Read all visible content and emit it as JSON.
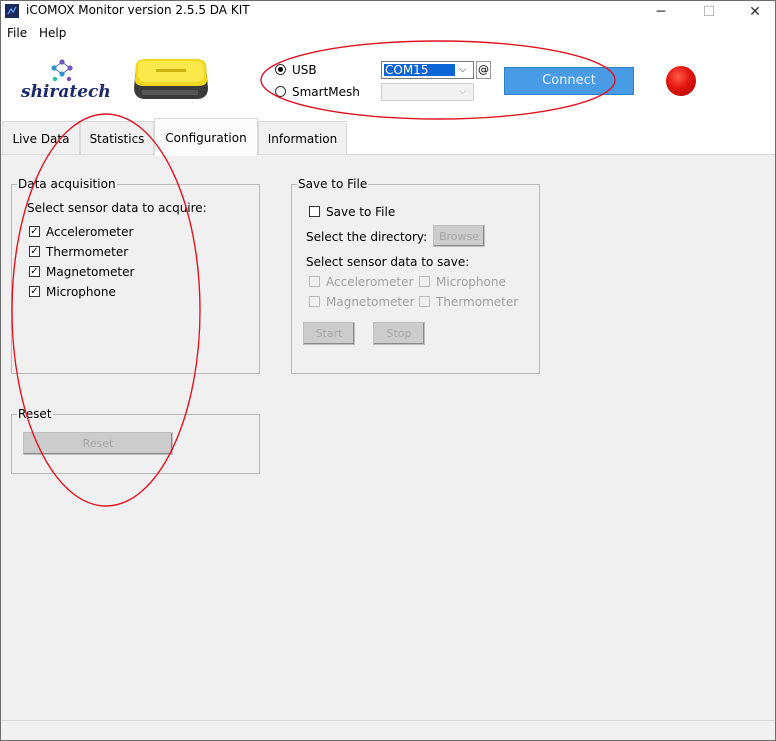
{
  "window": {
    "title": "iCOMOX Monitor version 2.5.5 DA KIT",
    "minimize": "─",
    "maximize": "☐",
    "close": "✕"
  },
  "menu": {
    "file": "File",
    "help": "Help"
  },
  "branding": {
    "logo_text": "shiratech"
  },
  "connection": {
    "usb_label": "USB",
    "smartmesh_label": "SmartMesh",
    "usb_selected": true,
    "com_port": "COM15",
    "at_button": "@",
    "connect_button": "Connect",
    "status_color": "#e3140d"
  },
  "tabs": [
    {
      "label": "Live Data"
    },
    {
      "label": "Statistics"
    },
    {
      "label": "Configuration",
      "active": true
    },
    {
      "label": "Information"
    }
  ],
  "data_acquisition": {
    "title": "Data acquisition",
    "prompt": "Select sensor data to acquire:",
    "sensors": [
      {
        "label": "Accelerometer",
        "checked": true
      },
      {
        "label": "Thermometer",
        "checked": true
      },
      {
        "label": "Magnetometer",
        "checked": true
      },
      {
        "label": "Microphone",
        "checked": true
      }
    ]
  },
  "save_to_file": {
    "title": "Save to File",
    "checkbox_label": "Save to File",
    "directory_label": "Select the directory:",
    "browse_button": "Browse",
    "prompt": "Select sensor data to save:",
    "sensors": [
      "Accelerometer",
      "Microphone",
      "Magnetometer",
      "Thermometer"
    ],
    "start_button": "Start",
    "stop_button": "Stop"
  },
  "reset": {
    "title": "Reset",
    "button": "Reset"
  },
  "annotation_color": "#e0141e"
}
